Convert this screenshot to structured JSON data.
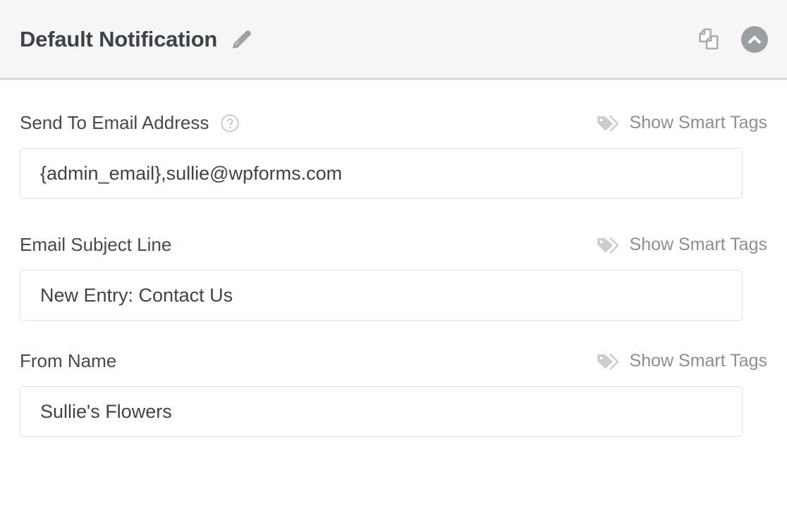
{
  "header": {
    "title": "Default Notification",
    "edit_icon": "pencil-icon",
    "duplicate_icon": "copy-pages-icon",
    "collapse_icon": "chevron-up-circle-icon"
  },
  "colors": {
    "header_bg": "#f6f6f6",
    "header_border": "#ccced0",
    "title_text": "#3c4349",
    "label_text": "#444a4f",
    "muted_text": "#8a8f94",
    "icon_gray": "#9b9fa3",
    "input_border": "#dfdfdf",
    "input_text": "#3e4347"
  },
  "smart_tags_label": "Show Smart Tags",
  "smart_tags_icon": "tags-icon",
  "fields": [
    {
      "label": "Send To Email Address",
      "has_help": true,
      "help_icon": "question-circle-icon",
      "value": "{admin_email},sullie@wpforms.com",
      "placeholder": ""
    },
    {
      "label": "Email Subject Line",
      "has_help": false,
      "value": "New Entry: Contact Us",
      "placeholder": ""
    },
    {
      "label": "From Name",
      "has_help": false,
      "value": "Sullie's Flowers",
      "placeholder": ""
    }
  ]
}
